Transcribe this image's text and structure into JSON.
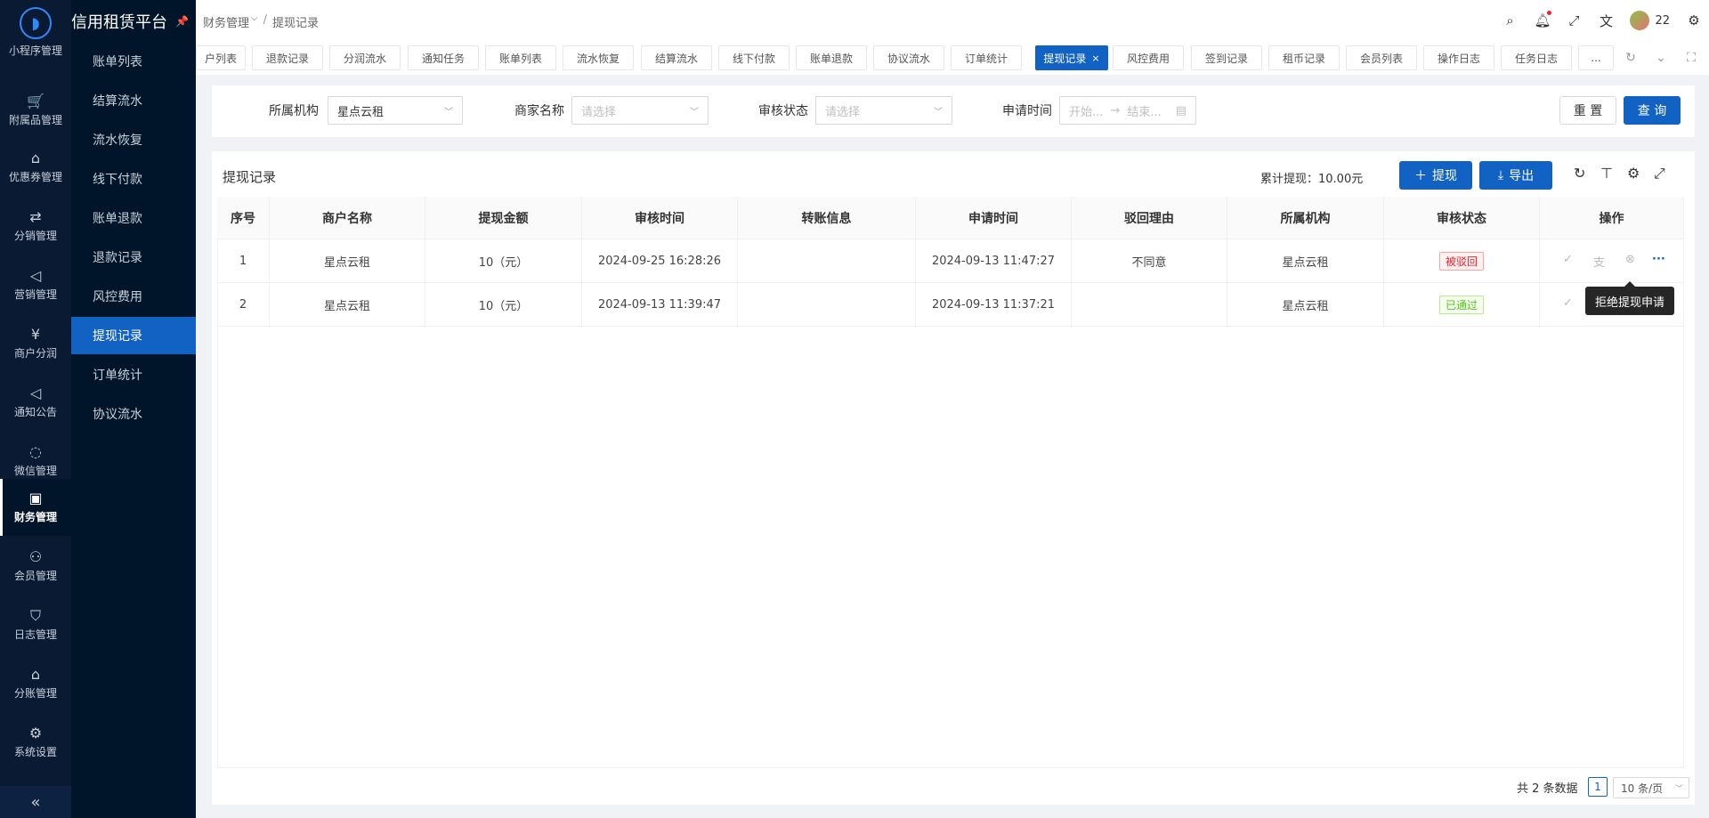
{
  "app": {
    "title": "信用租赁平台"
  },
  "rail": {
    "top_partial": "小程序管理",
    "items": [
      {
        "label": "附属品管理",
        "icon": "cart-icon",
        "glyph": "🛒"
      },
      {
        "label": "优惠券管理",
        "icon": "gift-icon",
        "glyph": "⌂"
      },
      {
        "label": "分销管理",
        "icon": "distribution-icon",
        "glyph": "⇄"
      },
      {
        "label": "营销管理",
        "icon": "megaphone-icon",
        "glyph": "◁"
      },
      {
        "label": "商户分润",
        "icon": "yen-icon",
        "glyph": "¥"
      },
      {
        "label": "通知公告",
        "icon": "announcement-icon",
        "glyph": "◁"
      },
      {
        "label": "微信管理",
        "icon": "wechat-icon",
        "glyph": "◌"
      },
      {
        "label": "财务管理",
        "icon": "finance-icon",
        "glyph": "▣",
        "active": true
      },
      {
        "label": "会员管理",
        "icon": "member-icon",
        "glyph": "⚇"
      },
      {
        "label": "日志管理",
        "icon": "shield-icon",
        "glyph": "⛉"
      },
      {
        "label": "分账管理",
        "icon": "split-icon",
        "glyph": "⌂"
      },
      {
        "label": "系统设置",
        "icon": "gear-icon",
        "glyph": "⚙"
      }
    ],
    "collapse": "«"
  },
  "submenu": {
    "items": [
      "账单列表",
      "结算流水",
      "流水恢复",
      "线下付款",
      "账单退款",
      "退款记录",
      "风控费用",
      "提现记录",
      "订单统计",
      "协议流水"
    ],
    "active_index": 7
  },
  "breadcrumb": {
    "parent": "财务管理",
    "current": "提现记录"
  },
  "user": {
    "name": "22"
  },
  "tabs": [
    {
      "label": "户列表"
    },
    {
      "label": "退款记录"
    },
    {
      "label": "分润流水"
    },
    {
      "label": "通知任务"
    },
    {
      "label": "账单列表"
    },
    {
      "label": "流水恢复"
    },
    {
      "label": "结算流水"
    },
    {
      "label": "线下付款"
    },
    {
      "label": "账单退款"
    },
    {
      "label": "协议流水"
    },
    {
      "label": "订单统计"
    },
    {
      "label": "提现记录",
      "active": true,
      "close": "×"
    },
    {
      "label": "风控费用"
    },
    {
      "label": "签到记录"
    },
    {
      "label": "租币记录"
    },
    {
      "label": "会员列表"
    },
    {
      "label": "操作日志"
    },
    {
      "label": "任务日志"
    },
    {
      "label": "..."
    }
  ],
  "filters": {
    "org_label": "所属机构",
    "org_value": "星点云租",
    "merchant_label": "商家名称",
    "merchant_placeholder": "请选择",
    "status_label": "审核状态",
    "status_placeholder": "请选择",
    "date_label": "申请时间",
    "date_start": "开始...",
    "date_arrow": "→",
    "date_end": "结束...",
    "reset": "重 置",
    "search": "查 询"
  },
  "card": {
    "title": "提现记录",
    "total": "累计提现：10.00元",
    "withdraw_btn": "提现",
    "export_btn": "导出"
  },
  "table": {
    "headers": [
      "序号",
      "商户名称",
      "提现金额",
      "审核时间",
      "转账信息",
      "申请时间",
      "驳回理由",
      "所属机构",
      "审核状态",
      "操作"
    ],
    "rows": [
      {
        "no": "1",
        "merchant": "星点云租",
        "amount": "10（元）",
        "review_time": "2024-09-25 16:28:26",
        "transfer": "",
        "apply_time": "2024-09-13 11:47:27",
        "reason": "不同意",
        "org": "星点云租",
        "status": "被驳回",
        "status_color": "#f5222d"
      },
      {
        "no": "2",
        "merchant": "星点云租",
        "amount": "10（元）",
        "review_time": "2024-09-13 11:39:47",
        "transfer": "",
        "apply_time": "2024-09-13 11:37:21",
        "reason": "",
        "org": "星点云租",
        "status": "已通过",
        "status_color": "#52c41a"
      }
    ]
  },
  "tooltip": "拒绝提现申请",
  "pagination": {
    "total": "共 2 条数据",
    "page": "1",
    "size": "10 条/页"
  },
  "colors": {
    "primary": "#1262c3",
    "sidebar": "#001529",
    "rail": "#0a1a33"
  }
}
